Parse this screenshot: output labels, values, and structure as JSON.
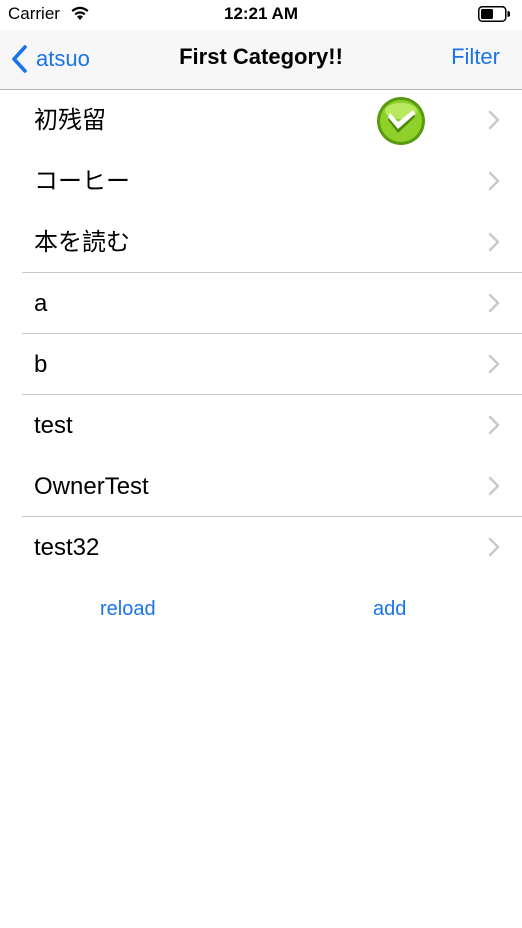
{
  "status_bar": {
    "carrier": "Carrier",
    "time": "12:21 AM",
    "wifi_icon": "wifi-icon",
    "battery_icon": "battery-icon"
  },
  "nav": {
    "back_label": "atsuo",
    "title": "First Category!!",
    "filter_label": "Filter",
    "accent_color": "#1a73e8"
  },
  "list": {
    "items": [
      {
        "label": "初残留",
        "checked": true
      },
      {
        "label": "コーヒー",
        "checked": false
      },
      {
        "label": "本を読む",
        "checked": false
      },
      {
        "label": "a",
        "checked": false
      },
      {
        "label": "b",
        "checked": false
      },
      {
        "label": "test",
        "checked": false
      },
      {
        "label": "OwnerTest",
        "checked": false
      },
      {
        "label": "test32",
        "checked": false
      }
    ]
  },
  "bottom": {
    "reload_label": "reload",
    "add_label": "add"
  }
}
